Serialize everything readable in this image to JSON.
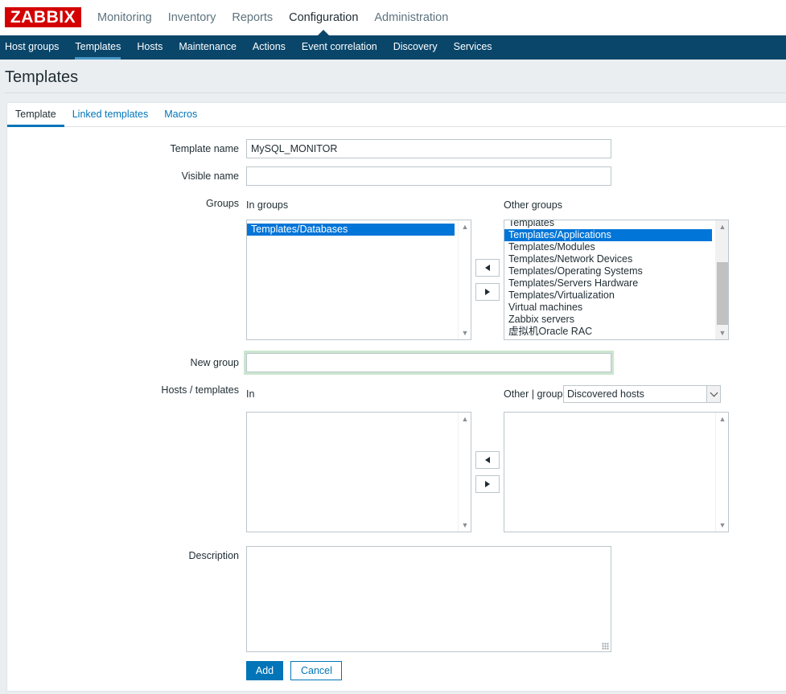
{
  "header": {
    "logo": "ZABBIX",
    "main_nav": [
      "Monitoring",
      "Inventory",
      "Reports",
      "Configuration",
      "Administration"
    ],
    "active_main": "Configuration",
    "sub_nav": [
      "Host groups",
      "Templates",
      "Hosts",
      "Maintenance",
      "Actions",
      "Event correlation",
      "Discovery",
      "Services"
    ],
    "active_sub": "Templates"
  },
  "page": {
    "title": "Templates"
  },
  "tabs": [
    "Template",
    "Linked templates",
    "Macros"
  ],
  "form": {
    "template_name_label": "Template name",
    "template_name_value": "MySQL_MONITOR",
    "visible_name_label": "Visible name",
    "visible_name_value": "",
    "groups_label": "Groups",
    "in_groups_label": "In groups",
    "in_groups": [
      "Templates/Databases"
    ],
    "other_groups_label": "Other groups",
    "other_groups": [
      "Templates",
      "Templates/Applications",
      "Templates/Modules",
      "Templates/Network Devices",
      "Templates/Operating Systems",
      "Templates/Servers Hardware",
      "Templates/Virtualization",
      "Virtual machines",
      "Zabbix servers",
      "虚拟机Oracle RAC"
    ],
    "other_groups_selected": "Templates/Applications",
    "new_group_label": "New group",
    "new_group_value": "",
    "hosts_templates_label": "Hosts / templates",
    "in_label": "In",
    "other_group_label": "Other | group",
    "other_group_select": "Discovered hosts",
    "description_label": "Description",
    "description_value": "",
    "add_button": "Add",
    "cancel_button": "Cancel"
  },
  "colors": {
    "brand_red": "#d40000",
    "nav_dark": "#0a466a",
    "link_blue": "#0275b8",
    "selection_blue": "#0275d8"
  }
}
